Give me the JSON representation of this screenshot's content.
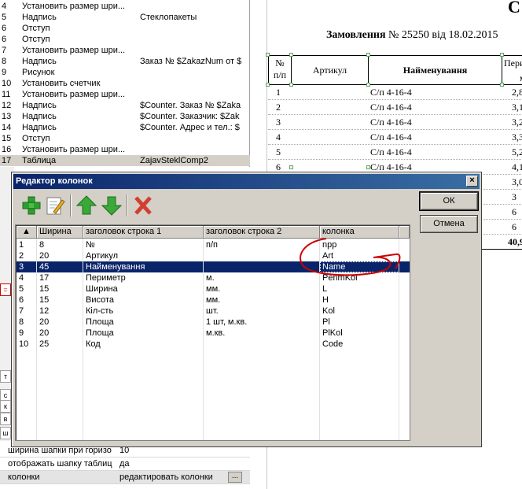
{
  "commands": [
    {
      "num": "4",
      "name": "Установить размер шри...",
      "value": ""
    },
    {
      "num": "5",
      "name": "Надпись",
      "value": "Стеклопакеты"
    },
    {
      "num": "6",
      "name": "Отступ",
      "value": ""
    },
    {
      "num": "6",
      "name": "Отступ",
      "value": ""
    },
    {
      "num": "7",
      "name": "Установить размер шри...",
      "value": ""
    },
    {
      "num": "8",
      "name": "Надпись",
      "value": "Заказ № $ZakazNum  от $"
    },
    {
      "num": "9",
      "name": "Рисунок",
      "value": ""
    },
    {
      "num": "10",
      "name": "Установить счетчик",
      "value": ""
    },
    {
      "num": "11",
      "name": "Установить размер шри...",
      "value": ""
    },
    {
      "num": "12",
      "name": "Надпись",
      "value": "$Counter. Заказ № $Zaka"
    },
    {
      "num": "13",
      "name": "Надпись",
      "value": "$Counter. Заказчик: $Zak"
    },
    {
      "num": "14",
      "name": "Надпись",
      "value": "$Counter. Адрес и тел.: $"
    },
    {
      "num": "15",
      "name": "Отступ",
      "value": ""
    },
    {
      "num": "16",
      "name": "Установить размер шри...",
      "value": ""
    },
    {
      "num": "17",
      "name": "Таблица",
      "value": "ZajavSteklComp2"
    }
  ],
  "gutter_tabs": [
    "=",
    "т",
    "с",
    "к",
    "в",
    "ш"
  ],
  "properties": [
    {
      "name": "ширина шапки при горизо",
      "value": "10"
    },
    {
      "name": "отображать шапку таблиц",
      "value": "да"
    },
    {
      "name": "колонки",
      "value": "редактировать колонки",
      "button": "..."
    }
  ],
  "report": {
    "letter": "С",
    "order_label": "Замовлення",
    "order_number": "№ 25250",
    "order_date": "від 18.02.2015",
    "headers": {
      "num_line1": "№",
      "num_line2": "п/п",
      "article": "Артикул",
      "name": "Найменування",
      "perimeter_line1": "Периме",
      "perimeter_line2": "м."
    },
    "rows": [
      {
        "n": "1",
        "name": "С/п 4-16-4",
        "val": "2,8"
      },
      {
        "n": "2",
        "name": "С/п 4-16-4",
        "val": "3,1"
      },
      {
        "n": "3",
        "name": "С/п 4-16-4",
        "val": "3,2"
      },
      {
        "n": "4",
        "name": "С/п 4-16-4",
        "val": "3,3"
      },
      {
        "n": "5",
        "name": "С/п 4-16-4",
        "val": "5,2"
      },
      {
        "n": "6",
        "name": "С/п 4-16-4",
        "val": "4,1"
      },
      {
        "n": "",
        "name": "",
        "val": "3,0"
      },
      {
        "n": "",
        "name": "",
        "val": "3"
      },
      {
        "n": "",
        "name": "",
        "val": "6"
      },
      {
        "n": "",
        "name": "",
        "val": "6"
      }
    ],
    "total": "40,9"
  },
  "dialog": {
    "title": "Редактор колонок",
    "close": "×",
    "ok": "ОК",
    "cancel": "Отмена",
    "toolbar": [
      "add-icon",
      "edit-icon",
      "move-up-icon",
      "move-down-icon",
      "delete-icon"
    ],
    "columns": [
      "▲",
      "Ширина",
      "заголовок строка 1",
      "заголовок строка 2",
      "колонка"
    ],
    "rows": [
      {
        "idx": "1",
        "width": "8",
        "h1": "№",
        "h2": "п/п",
        "col": "npp"
      },
      {
        "idx": "2",
        "width": "20",
        "h1": "Артикул",
        "h2": "",
        "col": "Art"
      },
      {
        "idx": "3",
        "width": "45",
        "h1": "Найменування",
        "h2": "",
        "col": "Name"
      },
      {
        "idx": "4",
        "width": "17",
        "h1": "Периметр",
        "h2": "м.",
        "col": "PerimKol"
      },
      {
        "idx": "5",
        "width": "15",
        "h1": "Ширина",
        "h2": "мм.",
        "col": "L"
      },
      {
        "idx": "6",
        "width": "15",
        "h1": "Висота",
        "h2": "мм.",
        "col": "H"
      },
      {
        "idx": "7",
        "width": "12",
        "h1": "Кіл-сть",
        "h2": "шт.",
        "col": "Kol"
      },
      {
        "idx": "8",
        "width": "20",
        "h1": "Площа",
        "h2": "1 шт, м.кв.",
        "col": "Pl"
      },
      {
        "idx": "9",
        "width": "20",
        "h1": "Площа",
        "h2": "м.кв.",
        "col": "PlKol"
      },
      {
        "idx": "10",
        "width": "25",
        "h1": "Код",
        "h2": "",
        "col": "Code"
      }
    ],
    "selected_row": 2
  },
  "colors": {
    "selection": "#0a246a",
    "titlebar": "#0a246a",
    "annotation": "#cc0000"
  }
}
